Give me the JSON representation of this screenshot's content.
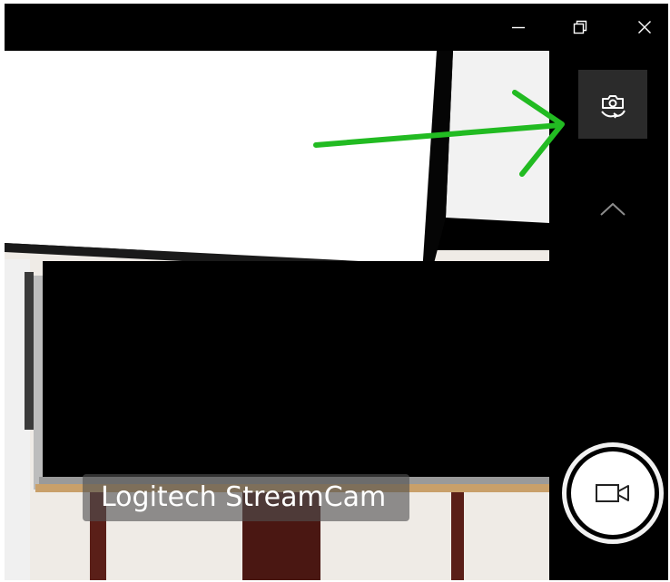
{
  "window": {
    "controls": {
      "minimize_icon": "minimize-icon",
      "restore_icon": "restore-icon",
      "close_icon": "close-icon"
    }
  },
  "viewfinder": {
    "camera_name": "Logitech StreamCam"
  },
  "side_rail": {
    "switch_camera_icon": "switch-camera-icon",
    "expand_icon": "chevron-up-icon",
    "record_icon": "video-camera-icon"
  },
  "annotation": {
    "arrow_color": "#22bb22"
  },
  "colors": {
    "background": "#000000",
    "switch_button_bg": "#2b2b2b",
    "label_bg": "rgba(80,80,80,0.62)"
  }
}
